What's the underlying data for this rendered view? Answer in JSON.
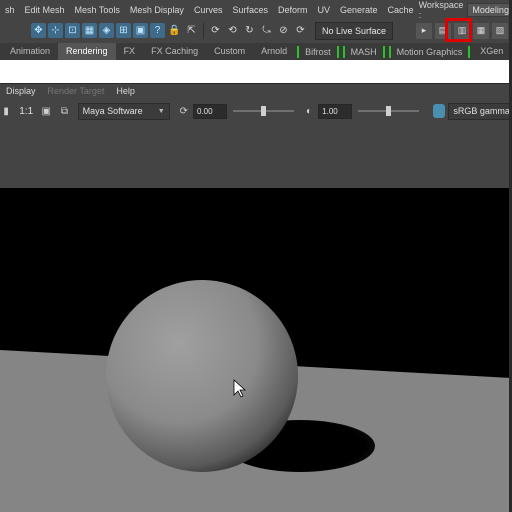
{
  "menubar": {
    "items": [
      "sh",
      "Edit Mesh",
      "Mesh Tools",
      "Mesh Display",
      "Curves",
      "Surfaces",
      "Deform",
      "UV",
      "Generate",
      "Cache"
    ],
    "workspace_label": "Workspace :",
    "workspace_value": "Modeling"
  },
  "toolbar": {
    "live_surface": "No Live Surface"
  },
  "shelf_tabs": [
    {
      "label": "Animation"
    },
    {
      "label": "Rendering",
      "active": true
    },
    {
      "label": "FX"
    },
    {
      "label": "FX Caching"
    },
    {
      "label": "Custom"
    },
    {
      "label": "Arnold"
    },
    {
      "label": "Bifrost"
    },
    {
      "label": "MASH"
    },
    {
      "label": "Motion Graphics"
    },
    {
      "label": "XGen"
    }
  ],
  "render_view": {
    "menu": [
      "Display",
      "Render Target",
      "Help"
    ],
    "ratio": "1:1",
    "renderer": "Maya Software",
    "exposure": "0.00",
    "gamma_value": "1.00",
    "color_space": "sRGB gamma",
    "exposure_level": 0.5,
    "gamma_level": 0.5
  },
  "icons": {
    "highlighted": "render-settings-icon"
  }
}
